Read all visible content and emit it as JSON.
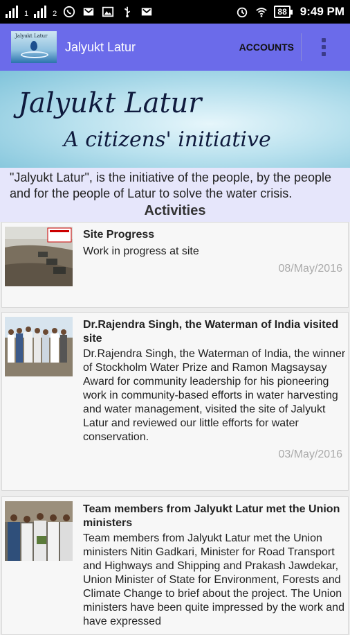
{
  "status_bar": {
    "sim1": "1",
    "sim2": "2",
    "battery": "88",
    "time": "9:49 PM"
  },
  "app_bar": {
    "title": "Jalyukt Latur",
    "accounts_label": "ACCOUNTS",
    "logo_text": "Jalyukt Latur"
  },
  "banner": {
    "line1": "Jalyukt Latur",
    "line2": "A citizens' initiative"
  },
  "intro": {
    "line1": "\"Jalyukt Latur\", is the initiative of the people, by the people",
    "line2": "and for the people of Latur to solve the water crisis."
  },
  "activities_heading": "Activities",
  "activities": [
    {
      "title": "Site Progress",
      "body": "Work in progress at site",
      "date": "08/May/2016"
    },
    {
      "title": "Dr.Rajendra Singh, the Waterman of India visited site",
      "body": "Dr.Rajendra Singh, the Waterman of India, the winner of Stockholm Water Prize and Ramon Magsaysay Award for community leadership for his pioneering work in community-based efforts in water harvesting and water management, visited the site of Jalyukt Latur and reviewed our little efforts for water conservation.",
      "date": "03/May/2016"
    },
    {
      "title": "Team members from Jalyukt Latur met the Union ministers",
      "body": "Team members from Jalyukt Latur met the Union ministers Nitin Gadkari, Minister for Road Transport and Highways and Shipping and Prakash Jawdekar, Union Minister of State for Environment, Forests and Climate Change to brief about the project. The Union ministers have been quite impressed by the work and have expressed",
      "date": ""
    }
  ]
}
